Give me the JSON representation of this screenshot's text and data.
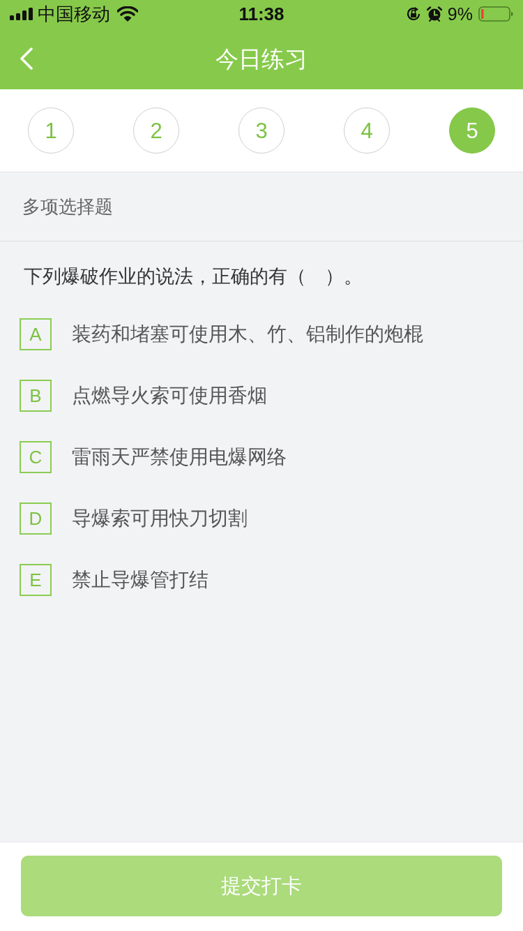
{
  "status_bar": {
    "carrier": "中国移动",
    "time": "11:38",
    "battery": "9%"
  },
  "nav_bar": {
    "title": "今日练习"
  },
  "question_tabs": [
    {
      "label": "1",
      "selected": false
    },
    {
      "label": "2",
      "selected": false
    },
    {
      "label": "3",
      "selected": false
    },
    {
      "label": "4",
      "selected": false
    },
    {
      "label": "5",
      "selected": true
    }
  ],
  "question_type": "多项选择题",
  "question": {
    "text": "下列爆破作业的说法，正确的有（　）。",
    "options": [
      {
        "letter": "A",
        "text": "装药和堵塞可使用木、竹、铝制作的炮棍",
        "selected": false
      },
      {
        "letter": "B",
        "text": "点燃导火索可使用香烟",
        "selected": false
      },
      {
        "letter": "C",
        "text": "雷雨天严禁使用电爆网络",
        "selected": false
      },
      {
        "letter": "D",
        "text": "导爆索可用快刀切割",
        "selected": false
      },
      {
        "letter": "E",
        "text": "禁止导爆管打结",
        "selected": false
      }
    ]
  },
  "submit_button": {
    "label": "提交打卡",
    "disabled": true
  }
}
